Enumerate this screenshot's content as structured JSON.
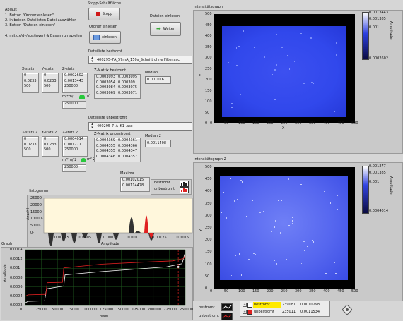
{
  "instructions": {
    "title": "Ablauf:",
    "steps": [
      "1. Button \"Ordner einlesen\"",
      "2. in beiden Dateilisten Datei auswählen",
      "3. Button \"Dateien einlesen\""
    ],
    "note": "4. mit dx/dy/abs/invert & Basen rumspielen"
  },
  "stop": {
    "title": "Stopp-Schaltfläche",
    "label": "Stopp"
  },
  "folder": {
    "title": "Ordner einlesen",
    "label": "einlesen"
  },
  "files": {
    "title": "Dateien einlesen",
    "label": "Weiter"
  },
  "list1": {
    "title": "Dateiliste bestromt",
    "value": "400295-7A_57mA_150s_Schnitt ohne Filter.asc"
  },
  "list2": {
    "title": "Dateiliste unbestromt",
    "value": "400295-7_A_K1 .asc"
  },
  "stats1": {
    "x_title": "X-stats",
    "x": [
      "0",
      "0.0233",
      "500"
    ],
    "y_title": "Y-stats",
    "y": [
      "0",
      "0.0233",
      "500"
    ],
    "z_title": "Z-stats",
    "z": [
      "0.0002602",
      "0.0013443",
      "250000"
    ],
    "unit_label": "m/*m/",
    "unit_suffix": "m²",
    "count": "250000"
  },
  "stats2": {
    "x_title": "X-stats 2",
    "x": [
      "0",
      "0.0233",
      "500"
    ],
    "y_title": "Y-stats 2",
    "y": [
      "0",
      "0.0233",
      "500"
    ],
    "z_title": "Z-stats 2",
    "z": [
      "0.0004014",
      "0.001277",
      "250000"
    ],
    "unit_label": "m/*m/ 2",
    "unit_suffix": "m² 2",
    "count": "250000"
  },
  "zmatrix1": {
    "title": "Z-Matrix bestromt",
    "rows": [
      [
        "0.0003093",
        "0.0003095"
      ],
      [
        "0.0003054",
        "0.000309"
      ],
      [
        "0.0003084",
        "0.0003075"
      ],
      [
        "0.0003069",
        "0.0003071"
      ]
    ]
  },
  "zmatrix2": {
    "title": "Z-Matrix unbestromt",
    "rows": [
      [
        "0.0004369",
        "0.0004361"
      ],
      [
        "0.0004355",
        "0.0004366"
      ],
      [
        "0.0004355",
        "0.0004347"
      ],
      [
        "0.0004346",
        "0.0004357"
      ]
    ]
  },
  "median1": {
    "title": "Median",
    "value": "0.0010161"
  },
  "median2": {
    "title": "Median 2",
    "value": "0.0011408"
  },
  "maxima": {
    "title": "Maxima",
    "values": [
      "0.00102015",
      "0.00114478"
    ]
  },
  "legend_top": {
    "items": [
      "bestromt",
      "unbestromt"
    ]
  },
  "histogram": {
    "title": "Histogramm",
    "xlabel": "Amplitude",
    "ylabel": "Anzahl",
    "yticks": [
      "25000-",
      "20000-",
      "15000-",
      "10000-",
      "5000-",
      "0-"
    ],
    "xticks": [
      "0.00025",
      "0.0005",
      "0.00075",
      "0.001",
      "0.00125",
      "0.0015"
    ]
  },
  "graph": {
    "title": "Graph",
    "xlabel": "pixel",
    "ylabel": "Amplitude",
    "yticks": [
      "0.0014",
      "0.0012",
      "0.001",
      "0.0008",
      "0.0006",
      "0.0004",
      "0.0002"
    ],
    "xticks": [
      "0",
      "25000",
      "50000",
      "75000",
      "100000",
      "125000",
      "150000",
      "175000",
      "200000",
      "225000",
      "250000"
    ]
  },
  "intensity1": {
    "title": "Intensitätsgraph",
    "xlabel": "X",
    "ylabel": "Y",
    "yticks": [
      "500",
      "450",
      "400",
      "350",
      "300",
      "250",
      "200",
      "150",
      "100",
      "50",
      "0"
    ],
    "xticks": [
      "0",
      "50",
      "100",
      "150",
      "200",
      "250",
      "300",
      "350",
      "400",
      "450",
      "500"
    ],
    "scale_label": "Amplitude",
    "scale": [
      "0.0013443",
      "0.001385",
      "0.001",
      "0.0002602"
    ]
  },
  "intensity2": {
    "title": "Intensitätsgraph 2",
    "xlabel": "X",
    "ylabel": "Y",
    "yticks": [
      "500",
      "450",
      "400",
      "350",
      "300",
      "250",
      "200",
      "150",
      "100",
      "50",
      "0"
    ],
    "xticks": [
      "0",
      "50",
      "100",
      "150",
      "200",
      "250",
      "300",
      "350",
      "400",
      "450",
      "500"
    ],
    "scale_label": "Amplitude",
    "scale": [
      "0.001277",
      "0.001385",
      "0.001",
      "0.0004014"
    ]
  },
  "cursor_legend": {
    "labels": [
      "bestromt",
      "unbestromt"
    ],
    "rows": [
      {
        "name": "bestromt",
        "x": "239081",
        "y": "0.0010298"
      },
      {
        "name": "unbestromt",
        "x": "235011",
        "y": "0.0011534"
      }
    ]
  },
  "colors": {
    "bestromt": "#ffffff",
    "unbestromt": "#e02020",
    "plot_bg": "#000000",
    "hist_bg": "#fff7dc",
    "intensity": "#2b3fe0"
  }
}
